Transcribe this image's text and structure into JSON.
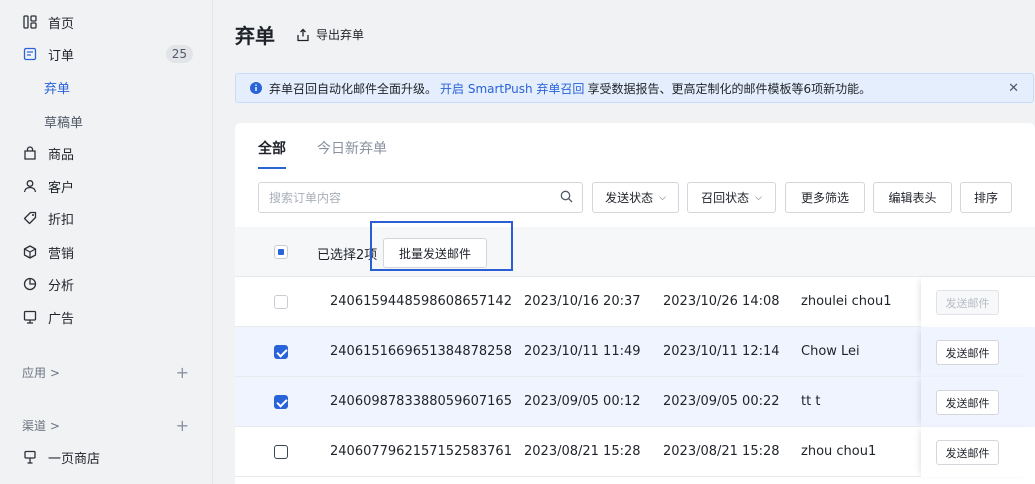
{
  "sidebar": {
    "items": [
      {
        "label": "首页",
        "icon": "grid-icon"
      },
      {
        "label": "订单",
        "icon": "order-icon",
        "badge": "25"
      },
      {
        "label": "弃单",
        "sub": true,
        "active": true
      },
      {
        "label": "草稿单",
        "sub": true
      },
      {
        "label": "商品",
        "icon": "bag-icon"
      },
      {
        "label": "客户",
        "icon": "user-icon"
      },
      {
        "label": "折扣",
        "icon": "tag-icon"
      },
      {
        "label": "营销",
        "icon": "cube-icon"
      },
      {
        "label": "分析",
        "icon": "pie-icon"
      },
      {
        "label": "广告",
        "icon": "ad-icon"
      }
    ],
    "apps_label": "应用 >",
    "channels_label": "渠道 >",
    "store_label": "一页商店"
  },
  "header": {
    "title": "弃单",
    "export_label": "导出弃单"
  },
  "notice": {
    "text1": "弃单召回自动化邮件全面升级。",
    "link": "开启 SmartPush 弃单召回",
    "text2": "享受数据报告、更高定制化的邮件模板等6项新功能。"
  },
  "tabs": [
    "全部",
    "今日新弃单"
  ],
  "filters": {
    "search_placeholder": "搜索订单内容",
    "send_status": "发送状态",
    "recall_status": "召回状态",
    "more_filters": "更多筛选",
    "edit_columns": "编辑表头",
    "sort": "排序"
  },
  "bulk": {
    "selected_text": "已选择2项",
    "bulk_send_label": "批量发送邮件"
  },
  "rows": [
    {
      "id": "2406159448598608657142",
      "created": "2023/10/16 20:37",
      "updated": "2023/10/26 14:08",
      "name": "zhoulei chou1",
      "action": "发送邮件",
      "checked": false,
      "disabled": true
    },
    {
      "id": "2406151669651384878258",
      "created": "2023/10/11 11:49",
      "updated": "2023/10/11 12:14",
      "name": "Chow Lei",
      "action": "发送邮件",
      "checked": true,
      "disabled": false
    },
    {
      "id": "2406098783388059607165",
      "created": "2023/09/05 00:12",
      "updated": "2023/09/05 00:22",
      "name": "tt t",
      "action": "发送邮件",
      "checked": true,
      "disabled": false
    },
    {
      "id": "2406077962157152583761",
      "created": "2023/08/21 15:28",
      "updated": "2023/08/21 15:28",
      "name": "zhou chou1",
      "action": "发送邮件",
      "checked": false,
      "disabled": false
    }
  ],
  "colors": {
    "accent": "#2962d9",
    "highlight_border": "#2b5ed4",
    "notice_bg": "#e5eefc"
  }
}
